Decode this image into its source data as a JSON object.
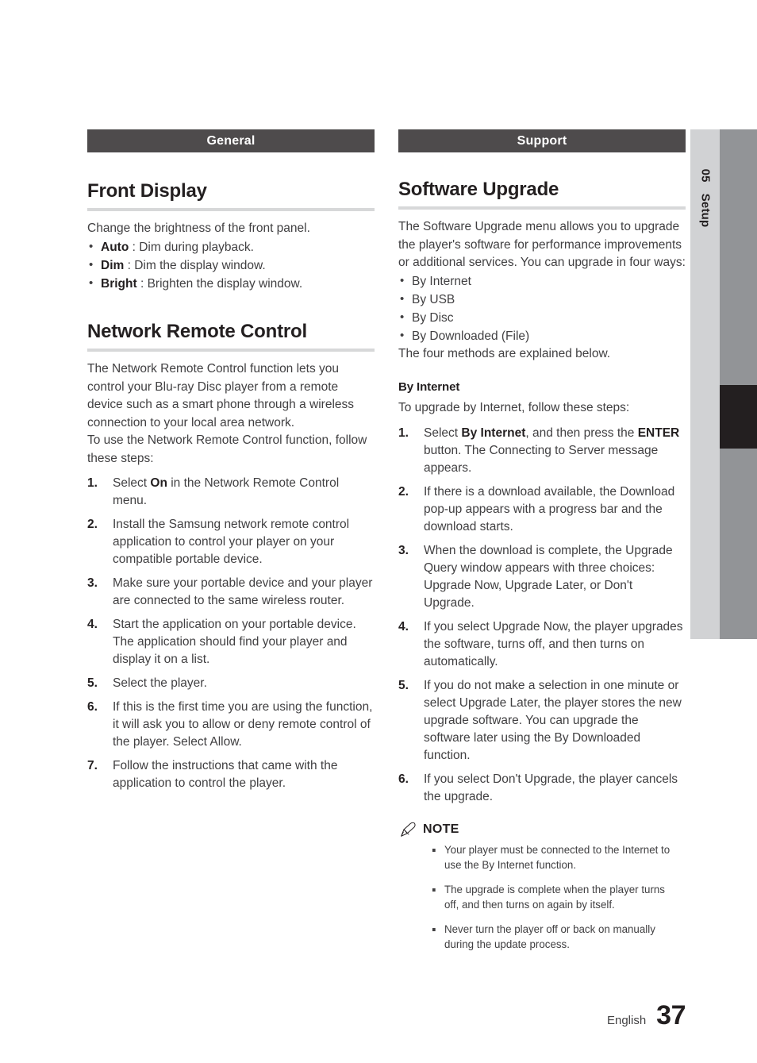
{
  "side_tab": {
    "chapter_number": "05",
    "chapter_name": "Setup"
  },
  "left_column": {
    "section_bar": "General",
    "sections": [
      {
        "title": "Front Display",
        "intro": "Change the brightness of the front panel.",
        "bullets": [
          {
            "term": "Auto",
            "sep": " : ",
            "text": "Dim during playback."
          },
          {
            "term": "Dim",
            "sep": " : ",
            "text": "Dim the display window."
          },
          {
            "term": "Bright",
            "sep": " : ",
            "text": "Brighten the display window."
          }
        ]
      },
      {
        "title": "Network Remote Control",
        "paragraphs": [
          "The Network Remote Control function lets you control your Blu-ray Disc player from a remote device such as a smart phone through a wireless connection to your local area network.",
          "To use the Network Remote Control function, follow these steps:"
        ],
        "steps": [
          "Select On in the Network Remote Control menu.",
          "Install the Samsung network remote control application to control your player on your compatible portable device.",
          "Make sure your portable device and your player are connected to the same wireless router.",
          "Start the application on your portable device. The application should find your player and display it on a list.",
          "Select the player.",
          "If this is the first time you are using the function, it will ask you to allow or deny remote control of the player. Select Allow.",
          "Follow the instructions that came with the application to control the player."
        ]
      }
    ]
  },
  "right_column": {
    "section_bar": "Support",
    "title": "Software Upgrade",
    "intro": "The Software Upgrade menu allows you to upgrade the player's software for performance improvements or additional services. You can upgrade in four ways:",
    "methods": [
      "By Internet",
      "By USB",
      "By Disc",
      "By Downloaded (File)"
    ],
    "methods_footer": "The four methods are explained below.",
    "subsection": {
      "title": "By Internet",
      "intro": "To upgrade by Internet, follow these steps:",
      "steps": [
        "Select By Internet, and then press the ENTER button. The Connecting to Server message appears.",
        "If there is a download available, the Download pop-up appears with a progress bar and the download starts.",
        "When the download is complete, the Upgrade Query window appears with three choices: Upgrade Now, Upgrade Later, or Don't Upgrade.",
        "If you select Upgrade Now, the player upgrades the software, turns off, and then turns on automatically.",
        "If you do not make a selection in one minute or select Upgrade Later, the player stores the new upgrade software. You can upgrade the software later using the By Downloaded function.",
        "If you select Don't Upgrade, the player cancels the upgrade."
      ]
    },
    "note": {
      "label": "NOTE",
      "icon": "pencil-icon",
      "items": [
        "Your player must be connected to the Internet to use the By Internet function.",
        "The upgrade is complete when the player turns off, and then turns on again by itself.",
        "Never turn the player off or back on manually during the update process."
      ]
    }
  },
  "footer": {
    "language": "English",
    "page_number": "37"
  },
  "colors": {
    "section_bar_bg": "#4e4b4c",
    "rule": "#d7d8d9",
    "side_tab_light": "#d1d2d4",
    "side_tab_dark": "#929497",
    "side_tab_black": "#231f20",
    "body_text": "#414042",
    "heading_text": "#231f20"
  }
}
